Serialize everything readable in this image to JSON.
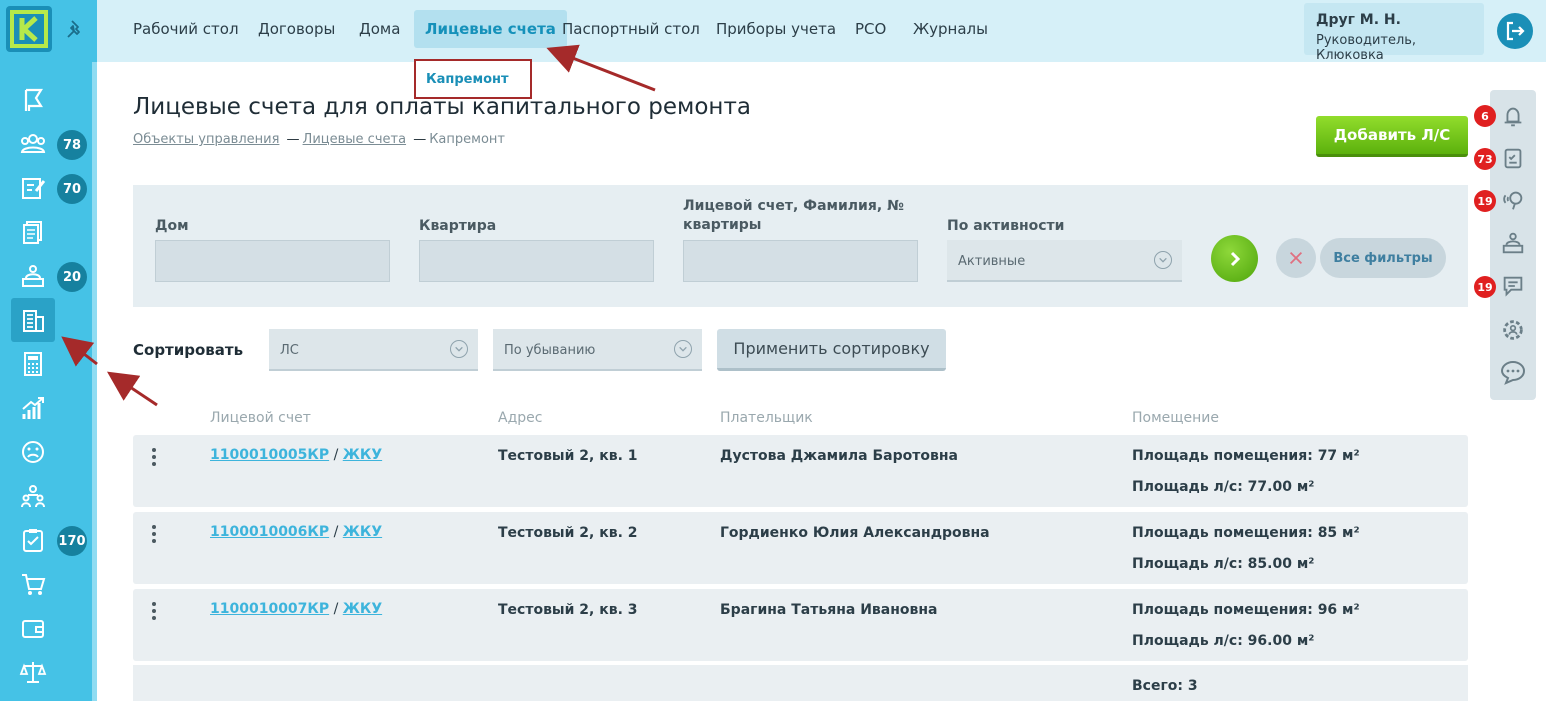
{
  "sidebar": {
    "logo_letter": "К",
    "badges": [
      "78",
      "70",
      "20",
      "170"
    ]
  },
  "topnav": {
    "items": [
      "Рабочий стол",
      "Договоры",
      "Дома",
      "Лицевые счета",
      "Паспортный стол",
      "Приборы учета",
      "РСО",
      "Журналы"
    ],
    "dropdown_item": "Капремонт"
  },
  "user": {
    "name": "Друг М. Н.",
    "role": "Руководитель, Клюковка"
  },
  "right_panel": {
    "badges": [
      "6",
      "73",
      "19",
      "19"
    ]
  },
  "page": {
    "title": "Лицевые счета для оплаты капитального ремонта",
    "breadcrumb": [
      "Объекты управления",
      "Лицевые счета",
      "Капремонт"
    ],
    "add_button": "Добавить Л/С"
  },
  "filters": {
    "house_label": "Дом",
    "flat_label": "Квартира",
    "account_label_line1": "Лицевой счет, Фамилия, №",
    "account_label_line2": "квартиры",
    "activity_label": "По активности",
    "activity_value": "Активные",
    "all_filters": "Все фильтры"
  },
  "sort": {
    "label": "Сортировать",
    "field_value": "ЛС",
    "order_value": "По убыванию",
    "apply_button": "Применить сортировку"
  },
  "table": {
    "headers": [
      "Лицевой счет",
      "Адрес",
      "Плательщик",
      "Помещение"
    ],
    "rows": [
      {
        "account": "1100010005КР",
        "sep": " / ",
        "link2": "ЖКУ",
        "address": "Тестовый 2, кв. 1",
        "payer": "Дустова Джамила Баротовна",
        "area_room": "Площадь помещения: 77 м²",
        "area_account": "Площадь л/с: 77.00 м²"
      },
      {
        "account": "1100010006КР",
        "sep": " / ",
        "link2": "ЖКУ",
        "address": "Тестовый 2, кв. 2",
        "payer": "Гордиенко Юлия Александровна",
        "area_room": "Площадь помещения: 85 м²",
        "area_account": "Площадь л/с: 85.00 м²"
      },
      {
        "account": "1100010007КР",
        "sep": " / ",
        "link2": "ЖКУ",
        "address": "Тестовый 2, кв. 3",
        "payer": "Брагина Татьяна Ивановна",
        "area_room": "Площадь помещения: 96 м²",
        "area_account": "Площадь л/с: 96.00 м²"
      }
    ],
    "total": "Всего: 3"
  },
  "colors": {
    "sidebar": "#45c2e6",
    "accent": "#1a8fb7",
    "green": "#5cb10d",
    "badge_red": "#e02020",
    "arrow": "#a52a2a"
  }
}
